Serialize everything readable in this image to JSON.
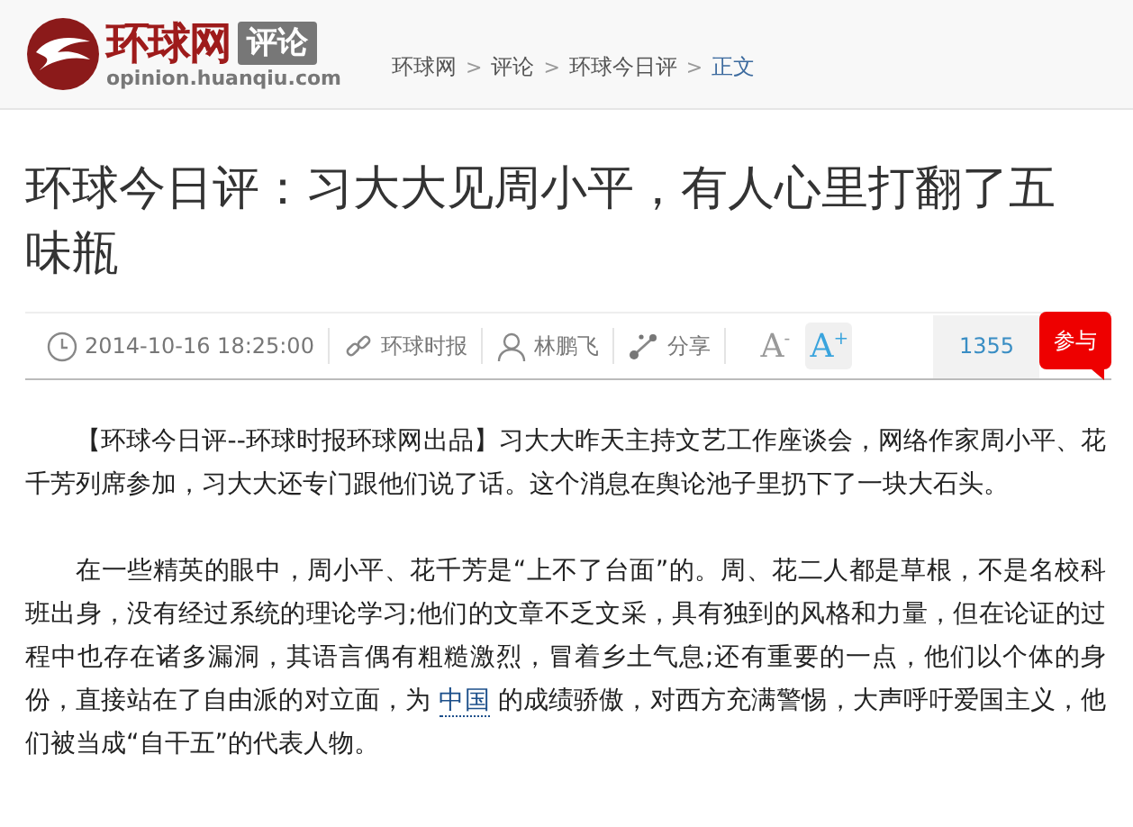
{
  "header": {
    "logo_text": "环球网",
    "section_badge": "评论",
    "domain": "opinion.huanqiu.com"
  },
  "breadcrumb": [
    {
      "label": "环球网",
      "selected": false
    },
    {
      "label": "评论",
      "selected": false
    },
    {
      "label": "环球今日评",
      "selected": false
    },
    {
      "label": "正文",
      "selected": true
    }
  ],
  "breadcrumb_separator": ">",
  "article": {
    "title": "环球今日评：习大大见周小平，有人心里打翻了五味瓶",
    "meta": [
      {
        "kind": "time",
        "text": "2014-10-16 18:25:00"
      },
      {
        "kind": "source",
        "text": "环球时报"
      },
      {
        "kind": "author",
        "text": "林鹏飞"
      },
      {
        "kind": "share",
        "text": "分享"
      }
    ],
    "font_buttons": [
      {
        "label": "A",
        "mark": "-",
        "selected": false
      },
      {
        "label": "A",
        "mark": "+",
        "selected": true
      }
    ],
    "comment_count": "1355",
    "join_button": "参与",
    "paragraphs": [
      [
        {
          "kind": "text",
          "text": "【环球今日评--环球时报环球网出品】习大大昨天主持文艺工作座谈会，网络作家周小平、花千芳列席参加，习大大还专门跟他们说了话。这个消息在舆论池子里扔下了一块大石头。"
        }
      ],
      [
        {
          "kind": "text",
          "text": "在一些精英的眼中，周小平、花千芳是“上不了台面”的。周、花二人都是草根，不是名校科班出身，没有经过系统的理论学习;他们的文章不乏文采，具有独到的风格和力量，但在论证的过程中也存在诸多漏洞，其语言偶有粗糙激烈，冒着乡土气息;还有重要的一点，他们以个体的身份，直接站在了自由派的对立面，为 "
        },
        {
          "kind": "link",
          "text": "中国"
        },
        {
          "kind": "text",
          "text": " 的成绩骄傲，对西方充满警惕，大声呼吁爱国主义，他们被当成“自干五”的代表人物。"
        }
      ]
    ]
  }
}
